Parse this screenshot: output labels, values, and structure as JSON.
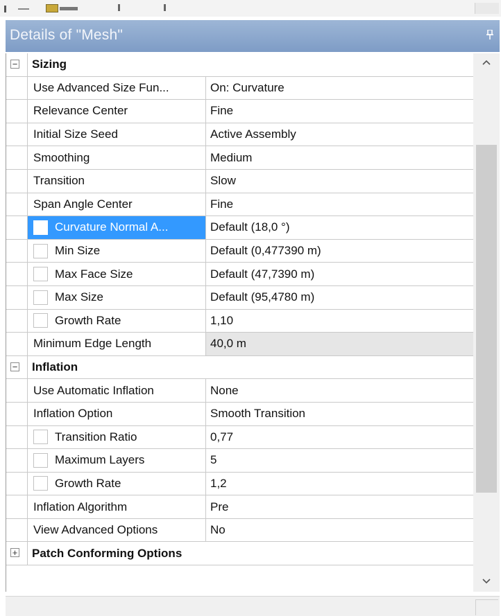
{
  "panel": {
    "title": "Details of \"Mesh\"",
    "pin_glyph": "📌"
  },
  "sections": {
    "sizing": {
      "label": "Sizing",
      "expander": "−",
      "rows": [
        {
          "label": "Use Advanced Size Fun...",
          "value": "On: Curvature"
        },
        {
          "label": "Relevance Center",
          "value": "Fine"
        },
        {
          "label": "Initial Size Seed",
          "value": "Active Assembly"
        },
        {
          "label": "Smoothing",
          "value": "Medium"
        },
        {
          "label": "Transition",
          "value": "Slow"
        },
        {
          "label": "Span Angle Center",
          "value": "Fine"
        },
        {
          "label": "Curvature Normal A...",
          "value": "Default (18,0 °)"
        },
        {
          "label": "Min Size",
          "value": "Default (0,477390 m)"
        },
        {
          "label": "Max Face Size",
          "value": "Default (47,7390 m)"
        },
        {
          "label": "Max Size",
          "value": "Default (95,4780 m)"
        },
        {
          "label": "Growth Rate",
          "value": "1,10"
        },
        {
          "label": "Minimum Edge Length",
          "value": "40,0 m"
        }
      ]
    },
    "inflation": {
      "label": "Inflation",
      "expander": "−",
      "rows": [
        {
          "label": "Use Automatic Inflation",
          "value": "None"
        },
        {
          "label": "Inflation Option",
          "value": "Smooth Transition"
        },
        {
          "label": "Transition Ratio",
          "value": "0,77"
        },
        {
          "label": "Maximum Layers",
          "value": "5"
        },
        {
          "label": "Growth Rate",
          "value": "1,2"
        },
        {
          "label": "Inflation Algorithm",
          "value": "Pre"
        },
        {
          "label": "View Advanced Options",
          "value": "No"
        }
      ]
    },
    "patch": {
      "label": "Patch Conforming Options",
      "expander": "+"
    }
  },
  "scrollbar": {
    "up_glyph": "^",
    "down_glyph": "v"
  },
  "colors": {
    "title_bar": "#8aa6cd",
    "selection": "#3399ff",
    "readonly_cell": "#e6e6e6"
  }
}
